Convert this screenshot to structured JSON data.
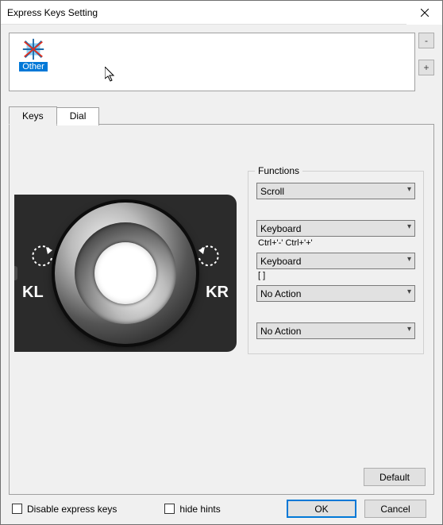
{
  "window": {
    "title": "Express Keys Setting"
  },
  "appstrip": {
    "items": [
      {
        "label": "Other",
        "icon": "burst-x-icon"
      }
    ],
    "minus_label": "-",
    "plus_label": "+"
  },
  "tabs": {
    "items": [
      {
        "label": "Keys",
        "active": true
      },
      {
        "label": "Dial",
        "active": false
      }
    ]
  },
  "dial": {
    "left_label": "KL",
    "right_label": "KR"
  },
  "functions": {
    "legend": "Functions",
    "rows": [
      {
        "select": "Scroll",
        "sub": ""
      },
      {
        "select": "Keyboard",
        "sub": "Ctrl+'-'  Ctrl+'+'"
      },
      {
        "select": "Keyboard",
        "sub": "[  ]"
      },
      {
        "select": "No Action",
        "sub": ""
      },
      {
        "select": "No Action",
        "sub": ""
      }
    ]
  },
  "buttons": {
    "default": "Default",
    "ok": "OK",
    "cancel": "Cancel"
  },
  "checkboxes": {
    "disable": "Disable express keys",
    "hide_hints": "hide hints"
  }
}
